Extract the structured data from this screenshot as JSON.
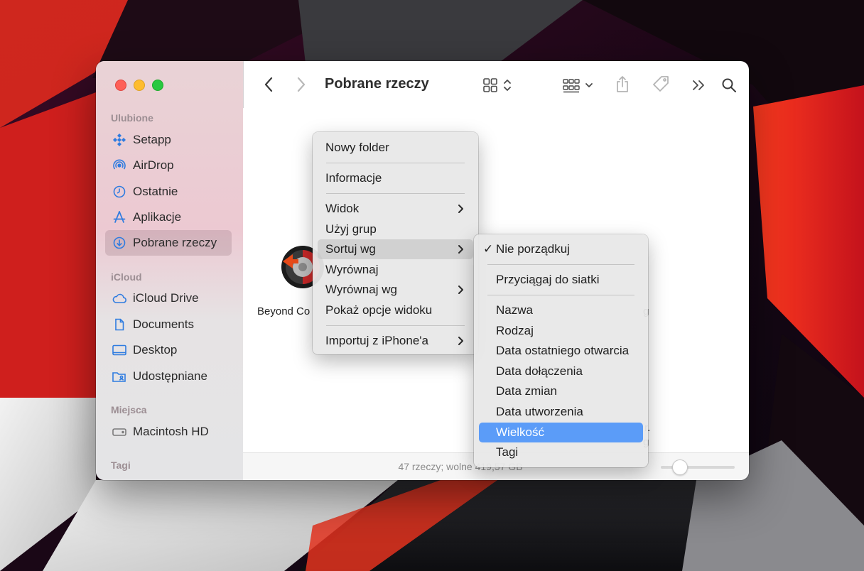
{
  "window": {
    "title": "Pobrane rzeczy"
  },
  "sidebar": {
    "sections": [
      {
        "label": "Ulubione"
      },
      {
        "label": "iCloud"
      },
      {
        "label": "Miejsca"
      },
      {
        "label": "Tagi"
      }
    ],
    "items": [
      {
        "label": "Setapp",
        "icon": "setapp-icon"
      },
      {
        "label": "AirDrop",
        "icon": "airdrop-icon"
      },
      {
        "label": "Ostatnie",
        "icon": "clock-icon"
      },
      {
        "label": "Aplikacje",
        "icon": "applications-icon"
      },
      {
        "label": "Pobrane rzeczy",
        "icon": "download-icon"
      },
      {
        "label": "iCloud Drive",
        "icon": "cloud-icon"
      },
      {
        "label": "Documents",
        "icon": "document-icon"
      },
      {
        "label": "Desktop",
        "icon": "desktop-icon"
      },
      {
        "label": "Udostępniane",
        "icon": "shared-folder-icon"
      },
      {
        "label": "Macintosh HD",
        "icon": "disk-icon"
      }
    ]
  },
  "content": {
    "file_label_left": "Beyond Co",
    "file_label_right_1": "g",
    "file_label_right_2": "r.",
    "file_label_right_3": "g"
  },
  "status": {
    "text": "47 rzeczy; wolne 419,57 GB"
  },
  "context_menu": {
    "items": [
      {
        "label": "Nowy folder"
      },
      {
        "label": "Informacje"
      },
      {
        "label": "Widok"
      },
      {
        "label": "Użyj grup"
      },
      {
        "label": "Sortuj wg"
      },
      {
        "label": "Wyrównaj"
      },
      {
        "label": "Wyrównaj wg"
      },
      {
        "label": "Pokaż opcje widoku"
      },
      {
        "label": "Importuj z iPhone'a"
      }
    ]
  },
  "submenu": {
    "check_mark": "✓",
    "items": [
      {
        "label": "Nie porządkuj"
      },
      {
        "label": "Przyciągaj do siatki"
      },
      {
        "label": "Nazwa"
      },
      {
        "label": "Rodzaj"
      },
      {
        "label": "Data ostatniego otwarcia"
      },
      {
        "label": "Data dołączenia"
      },
      {
        "label": "Data zmian"
      },
      {
        "label": "Data utworzenia"
      },
      {
        "label": "Wielkość"
      },
      {
        "label": "Tagi"
      }
    ]
  },
  "colors": {
    "selection_blue": "#5b9cf8",
    "sidebar_icon_blue": "#2f7ce0"
  }
}
